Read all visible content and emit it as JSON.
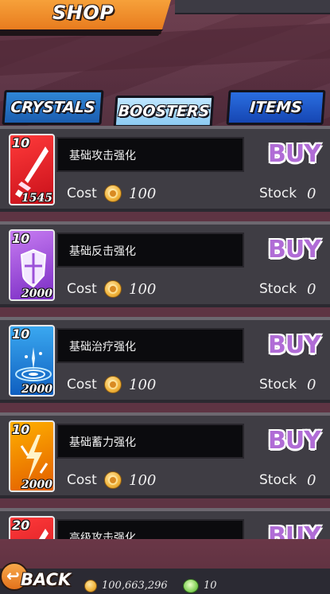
{
  "header": {
    "title": "SHOP"
  },
  "tabs": [
    {
      "label": "CRYSTALS"
    },
    {
      "label": "BOOSTERS",
      "active": true
    },
    {
      "label": "ITEMS"
    }
  ],
  "colors": {
    "accent": "#f6a13a",
    "buy": "#b06cd6",
    "row_bg": "#3f3d44"
  },
  "items": [
    {
      "level": "10",
      "count": "1545",
      "icon": "sword-icon",
      "name": "基础攻击强化",
      "buy_label": "BUY",
      "cost_label": "Cost",
      "cost": "100",
      "stock_label": "Stock",
      "stock": "0"
    },
    {
      "level": "10",
      "count": "2000",
      "icon": "shield-icon",
      "name": "基础反击强化",
      "buy_label": "BUY",
      "cost_label": "Cost",
      "cost": "100",
      "stock_label": "Stock",
      "stock": "0"
    },
    {
      "level": "10",
      "count": "2000",
      "icon": "healing-fountain-icon",
      "name": "基础治疗强化",
      "buy_label": "BUY",
      "cost_label": "Cost",
      "cost": "100",
      "stock_label": "Stock",
      "stock": "0"
    },
    {
      "level": "10",
      "count": "2000",
      "icon": "lightning-icon",
      "name": "基础蓄力强化",
      "buy_label": "BUY",
      "cost_label": "Cost",
      "cost": "100",
      "stock_label": "Stock",
      "stock": "0"
    },
    {
      "level": "20",
      "icon": "sword-icon",
      "name": "高级攻击强化",
      "buy_label": "BUY"
    }
  ],
  "footer": {
    "back_label": "BACK",
    "gold": "100,663,296",
    "gems": "10"
  }
}
